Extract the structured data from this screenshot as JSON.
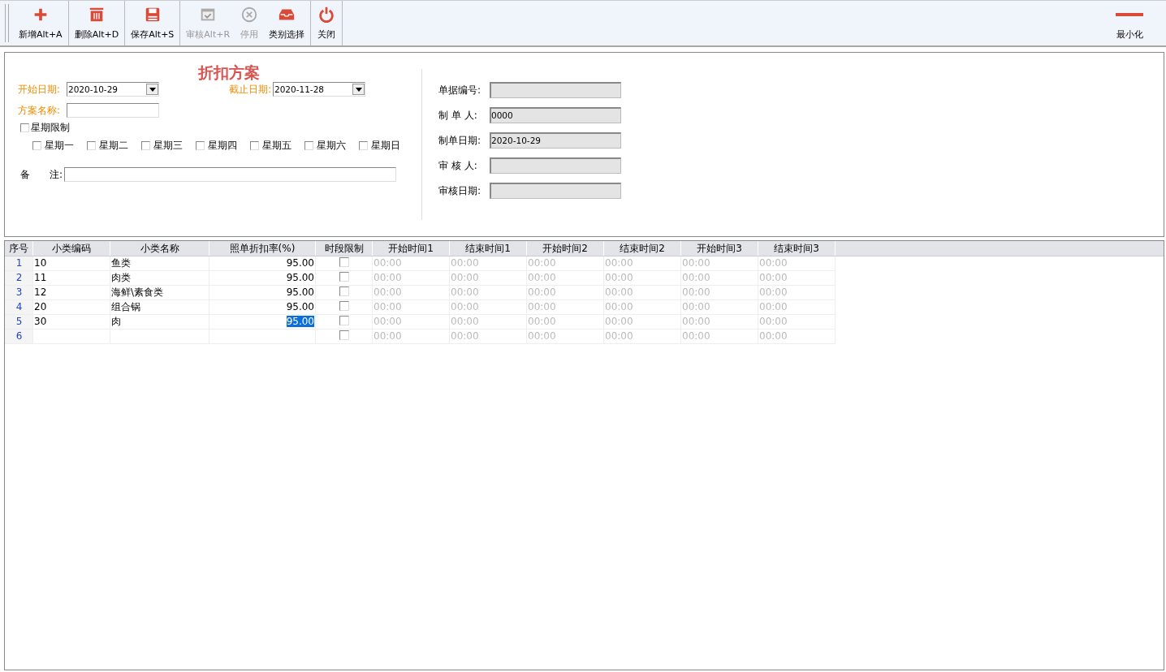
{
  "toolbar": {
    "buttons": [
      {
        "label": "新增Alt+A",
        "kind": "add",
        "disabled": false
      },
      {
        "label": "删除Alt+D",
        "kind": "delete",
        "disabled": false
      },
      {
        "label": "保存Alt+S",
        "kind": "save",
        "disabled": false
      },
      {
        "label": "审核Alt+R",
        "kind": "approve",
        "disabled": true
      },
      {
        "label": "停用",
        "kind": "disable",
        "disabled": true
      },
      {
        "label": "类别选择",
        "kind": "category",
        "disabled": false
      },
      {
        "label": "关闭",
        "kind": "close",
        "disabled": false
      }
    ],
    "minimize": {
      "label": "最小化"
    }
  },
  "form": {
    "title": "折扣方案",
    "start_date": {
      "label": "开始日期:",
      "value": "2020-10-29"
    },
    "end_date": {
      "label": "截止日期:",
      "value": "2020-11-28"
    },
    "scheme_name": {
      "label": "方案名称:"
    },
    "week_limit": {
      "label": "星期限制",
      "checked": false
    },
    "weekdays": [
      {
        "label": "星期一",
        "checked": false
      },
      {
        "label": "星期二",
        "checked": false
      },
      {
        "label": "星期三",
        "checked": false
      },
      {
        "label": "星期四",
        "checked": false
      },
      {
        "label": "星期五",
        "checked": false
      },
      {
        "label": "星期六",
        "checked": false
      },
      {
        "label": "星期日",
        "checked": false
      }
    ],
    "remark": {
      "label_1": "备",
      "label_2": "注:"
    },
    "info": [
      {
        "label": "单据编号:"
      },
      {
        "label": "制 单 人:",
        "value": "0000"
      },
      {
        "label": "制单日期:",
        "value": "2020-10-29"
      },
      {
        "label": "审 核 人:"
      },
      {
        "label": "审核日期:"
      }
    ]
  },
  "grid": {
    "columns": [
      "序号",
      "小类编码",
      "小类名称",
      "照单折扣率(%)",
      "时段限制",
      "开始时间1",
      "结束时间1",
      "开始时间2",
      "结束时间2",
      "开始时间3",
      "结束时间3"
    ],
    "rows": [
      {
        "no": "1",
        "code": "10",
        "name": "鱼类",
        "rate": "95.00",
        "selected": false,
        "time_limit": false,
        "times": [
          "00:00",
          "00:00",
          "00:00",
          "00:00",
          "00:00",
          "00:00"
        ]
      },
      {
        "no": "2",
        "code": "11",
        "name": "肉类",
        "rate": "95.00",
        "selected": false,
        "time_limit": false,
        "times": [
          "00:00",
          "00:00",
          "00:00",
          "00:00",
          "00:00",
          "00:00"
        ]
      },
      {
        "no": "3",
        "code": "12",
        "name": "海鲜\\素食类",
        "rate": "95.00",
        "selected": false,
        "time_limit": false,
        "times": [
          "00:00",
          "00:00",
          "00:00",
          "00:00",
          "00:00",
          "00:00"
        ]
      },
      {
        "no": "4",
        "code": "20",
        "name": "组合锅",
        "rate": "95.00",
        "selected": false,
        "time_limit": false,
        "times": [
          "00:00",
          "00:00",
          "00:00",
          "00:00",
          "00:00",
          "00:00"
        ]
      },
      {
        "no": "5",
        "code": "30",
        "name": "肉",
        "rate": "95.00",
        "selected": true,
        "time_limit": false,
        "times": [
          "00:00",
          "00:00",
          "00:00",
          "00:00",
          "00:00",
          "00:00"
        ]
      },
      {
        "no": "6",
        "time_limit": false,
        "times": [
          "00:00",
          "00:00",
          "00:00",
          "00:00",
          "00:00",
          "00:00"
        ]
      }
    ]
  }
}
